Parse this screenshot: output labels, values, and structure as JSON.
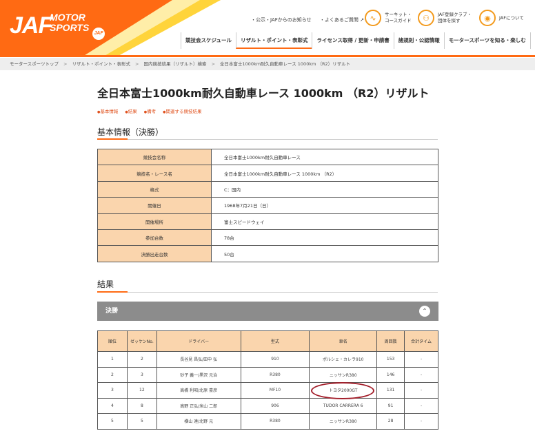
{
  "header": {
    "logo": {
      "main": "JAF",
      "sub_line1": "MOTOR",
      "sub_line2": "SPORTS",
      "badge": "JAF"
    },
    "toplinks": [
      "・公示・JAFからのお知らせ",
      "・よくあるご質問 ↗"
    ],
    "quick_links": [
      {
        "icon": "circuit-icon",
        "line1": "サーキット・",
        "line2": "コースガイド"
      },
      {
        "icon": "club-icon",
        "line1": "JAF登録クラブ・",
        "line2": "団体を探す"
      },
      {
        "icon": "car-icon",
        "line1": "JAFについて",
        "line2": ""
      }
    ],
    "nav": [
      "競技会スケジュール",
      "リザルト・ポイント・表彰式",
      "ライセンス取得 / 更新・申請書",
      "諸規則・公認情報",
      "モータースポーツを知る・楽しむ"
    ],
    "accent_color": "#ff6a13"
  },
  "breadcrumb": [
    "モータースポーツトップ",
    "リザルト・ポイント・表彰式",
    "国内競技結果（リザルト）検索",
    "全日本富士1000km耐久自動車レース 1000km （R2）リザルト"
  ],
  "page_title": "全日本富士1000km耐久自動車レース 1000km （R2）リザルト",
  "anchors": [
    "基本情報",
    "結果",
    "備考",
    "関連する競技結果"
  ],
  "basic_info": {
    "heading": "基本情報（決勝）",
    "rows": [
      {
        "key": "競技会名称",
        "value": "全日本富士1000km耐久自動車レース"
      },
      {
        "key": "競技名・レース名",
        "value": "全日本富士1000km耐久自動車レース 1000km （R2）"
      },
      {
        "key": "格式",
        "value": "C：国内"
      },
      {
        "key": "開催日",
        "value": "1968年7月21日（日）"
      },
      {
        "key": "開催場所",
        "value": "富士スピードウェイ"
      },
      {
        "key": "参加台数",
        "value": "78台"
      },
      {
        "key": "決勝出走台数",
        "value": "50台"
      }
    ]
  },
  "results": {
    "heading": "結果",
    "accordion_label": "決勝",
    "columns": [
      "順位",
      "ゼッケンNo.",
      "ドライバー",
      "型式",
      "車名",
      "周回数",
      "合計タイム"
    ],
    "rows": [
      [
        "1",
        "2",
        "長谷見 昌弘/田中 弘",
        "910",
        "ポルシェ・カレラ910",
        "153",
        "-"
      ],
      [
        "2",
        "3",
        "砂子 義一/黒沢 元治",
        "R380",
        "ニッサンR380",
        "146",
        "-"
      ],
      [
        "3",
        "12",
        "高橋 利昭/北原 豪彦",
        "MF10",
        "トヨタ2000GT",
        "131",
        "-"
      ],
      [
        "4",
        "8",
        "高野 正弘/米山 二郎",
        "906",
        "TUDOR CARRERA 6",
        "91",
        "-"
      ],
      [
        "5",
        "5",
        "横山 達/北野 元",
        "R380",
        "ニッサンR380",
        "28",
        "-"
      ]
    ]
  }
}
